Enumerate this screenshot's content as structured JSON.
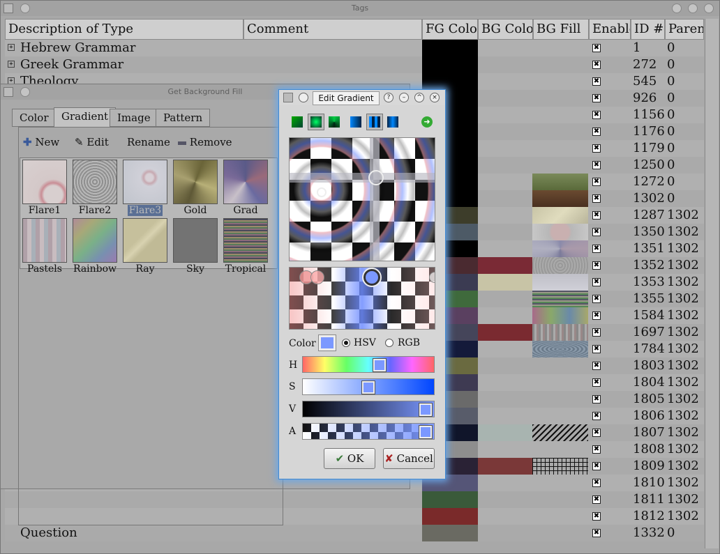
{
  "main": {
    "title": "Tags",
    "columns": [
      "Description of Type",
      "Comment",
      "FG Color",
      "BG Color",
      "BG Fill",
      "Enabled",
      "ID #",
      "Parent"
    ],
    "rows": [
      {
        "desc": "Hebrew Grammar",
        "id": "1",
        "parent": "0",
        "fg": "#000000",
        "bg": ""
      },
      {
        "desc": "Greek Grammar",
        "id": "272",
        "parent": "0",
        "fg": "#000000",
        "bg": ""
      },
      {
        "desc": "Theology",
        "id": "545",
        "parent": "0",
        "fg": "#000000",
        "bg": ""
      },
      {
        "desc": "",
        "id": "926",
        "parent": "0",
        "fg": "#000000",
        "bg": ""
      },
      {
        "desc": "",
        "id": "1156",
        "parent": "0",
        "fg": "#000000",
        "bg": ""
      },
      {
        "desc": "",
        "id": "1176",
        "parent": "0",
        "fg": "#000000",
        "bg": ""
      },
      {
        "desc": "",
        "id": "1179",
        "parent": "0",
        "fg": "#000000",
        "bg": ""
      },
      {
        "desc": "",
        "id": "1250",
        "parent": "0",
        "fg": "#000000",
        "bg": ""
      },
      {
        "desc": "",
        "id": "1272",
        "parent": "0",
        "fg": "#000000",
        "bg": ""
      },
      {
        "desc": "",
        "id": "1302",
        "parent": "0",
        "fg": "#000000",
        "bg": ""
      },
      {
        "desc": "",
        "id": "1287",
        "parent": "1302",
        "fg": "#3d3d2a",
        "bg": ""
      },
      {
        "desc": "",
        "id": "1350",
        "parent": "1302",
        "fg": "#4d5a66",
        "bg": ""
      },
      {
        "desc": "",
        "id": "1351",
        "parent": "1302",
        "fg": "#000000",
        "bg": ""
      },
      {
        "desc": "",
        "id": "1352",
        "parent": "1302",
        "fg": "#4a2a30",
        "bg": "#7a2a35"
      },
      {
        "desc": "",
        "id": "1353",
        "parent": "1302",
        "fg": "#3b3b52",
        "bg": "#c8c4a6"
      },
      {
        "desc": "",
        "id": "1355",
        "parent": "1302",
        "fg": "#3f6a3c",
        "bg": ""
      },
      {
        "desc": "",
        "id": "1584",
        "parent": "1302",
        "fg": "#5a4060",
        "bg": ""
      },
      {
        "desc": "",
        "id": "1697",
        "parent": "1302",
        "fg": "#45455a",
        "bg": "#7a2a30"
      },
      {
        "desc": "",
        "id": "1784",
        "parent": "1302",
        "fg": "#141a3a",
        "bg": ""
      },
      {
        "desc": "",
        "id": "1803",
        "parent": "1302",
        "fg": "#6a6a40",
        "bg": ""
      },
      {
        "desc": "",
        "id": "1804",
        "parent": "1302",
        "fg": "#3e3a52",
        "bg": ""
      },
      {
        "desc": "",
        "id": "1805",
        "parent": "1302",
        "fg": "#6a6a6a",
        "bg": ""
      },
      {
        "desc": "",
        "id": "1806",
        "parent": "1302",
        "fg": "#585c6a",
        "bg": ""
      },
      {
        "desc": "",
        "id": "1807",
        "parent": "1302",
        "fg": "#10152a",
        "bg": "#a8b4b0"
      },
      {
        "desc": "",
        "id": "1808",
        "parent": "1302",
        "fg": "#8e8e8e",
        "bg": ""
      },
      {
        "desc": "",
        "id": "1809",
        "parent": "1302",
        "fg": "#2a2235",
        "bg": "#7a3838"
      },
      {
        "desc": "",
        "id": "1810",
        "parent": "1302",
        "fg": "#555577",
        "bg": ""
      },
      {
        "desc": "",
        "id": "1811",
        "parent": "1302",
        "fg": "#3a5a3a",
        "bg": ""
      },
      {
        "desc": "",
        "id": "1812",
        "parent": "1302",
        "fg": "#7a2a2a",
        "bg": ""
      },
      {
        "desc": "Question",
        "id": "1332",
        "parent": "0",
        "fg": "#6a6a62",
        "bg": ""
      }
    ]
  },
  "bgfill": {
    "title": "Get Background Fill",
    "tabs": [
      "Color",
      "Gradient",
      "Image",
      "Pattern"
    ],
    "new": "New",
    "edit": "Edit",
    "rename": "Rename",
    "remove": "Remove",
    "items": [
      "Flare1",
      "Flare2",
      "Flare3",
      "Gold",
      "Grad",
      "Pastels",
      "Rainbow",
      "Ray",
      "Sky",
      "Tropical"
    ]
  },
  "dialog": {
    "title": "Edit Gradient",
    "color_label": "Color",
    "hsv": "HSV",
    "rgb": "RGB",
    "h": "H",
    "s": "S",
    "v": "V",
    "a": "A",
    "ok": "OK",
    "cancel": "Cancel",
    "h_value": 0.6,
    "s_value": 0.5,
    "v_value": 1.0,
    "a_value": 1.0
  }
}
